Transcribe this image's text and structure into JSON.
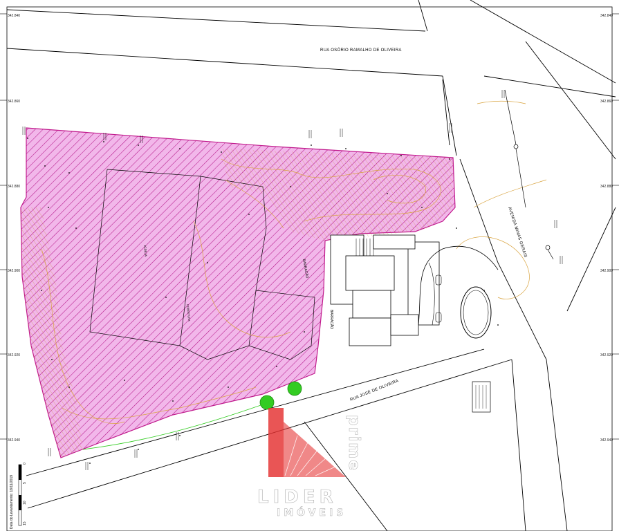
{
  "streets": {
    "north": "RUA OSÓRIO RAMALHO DE OLIVEIRA",
    "east": "AVENIDA MINAS GERAIS",
    "south": "RUA JOSÉ DE OLIVEIRA"
  },
  "buildings": {
    "barracao_upper": "BARRACÃO",
    "barracao_lower": "BARRACÃO",
    "igreja": "IGREJA",
    "cobertura": "COBERTURA"
  },
  "grid_labels": {
    "left": [
      "342.840",
      "342.860",
      "342.880",
      "342.900",
      "342.920",
      "342.940"
    ],
    "right": [
      "342.840",
      "342.860",
      "342.880",
      "342.900",
      "342.920",
      "342.940"
    ]
  },
  "survey_note": "Data do Levantamento: 18/11/2019",
  "scale_bar": {
    "ticks": [
      "0",
      "5",
      "10",
      "15"
    ]
  },
  "watermark": {
    "brand": "LIDER",
    "sub": "IMÓVEIS",
    "side": "prime"
  },
  "colors": {
    "hatch": "#c0198c",
    "fill": "#f2b7ea",
    "contour": "#d9a441",
    "tree": "#33cc22",
    "logo_red": "#e53030"
  }
}
